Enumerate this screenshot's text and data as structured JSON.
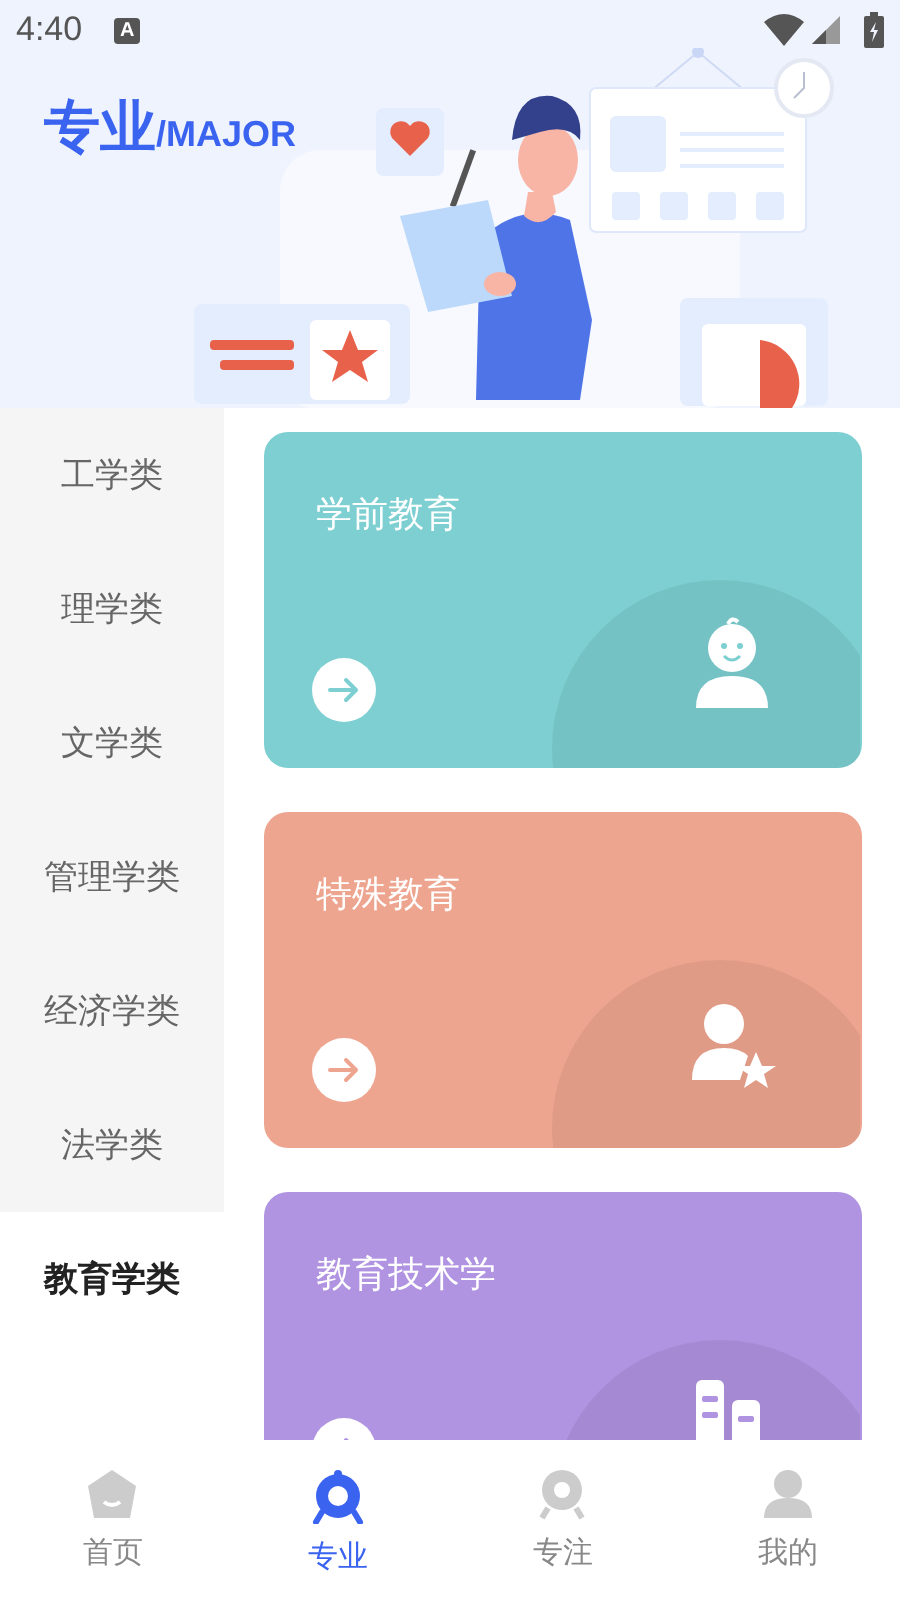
{
  "status_bar": {
    "time": "4:40",
    "keyboard_badge": "A"
  },
  "header": {
    "title": "专业",
    "subtitle": "/MAJOR"
  },
  "categories": [
    {
      "label": "工学类",
      "selected": false
    },
    {
      "label": "理学类",
      "selected": false
    },
    {
      "label": "文学类",
      "selected": false
    },
    {
      "label": "管理学类",
      "selected": false
    },
    {
      "label": "经济学类",
      "selected": false
    },
    {
      "label": "法学类",
      "selected": false
    },
    {
      "label": "教育学类",
      "selected": true
    }
  ],
  "majors": [
    {
      "name": "学前教育",
      "kind": "baby",
      "color": "#7dcfd1"
    },
    {
      "name": "特殊教育",
      "kind": "person-star",
      "color": "#eea58f"
    },
    {
      "name": "教育技术学",
      "kind": "buildings",
      "color": "#b093e1"
    }
  ],
  "bottom_nav": [
    {
      "label": "首页",
      "kind": "home",
      "selected": false
    },
    {
      "label": "专业",
      "kind": "major",
      "selected": true
    },
    {
      "label": "专注",
      "kind": "focus",
      "selected": false
    },
    {
      "label": "我的",
      "kind": "me",
      "selected": false
    }
  ]
}
